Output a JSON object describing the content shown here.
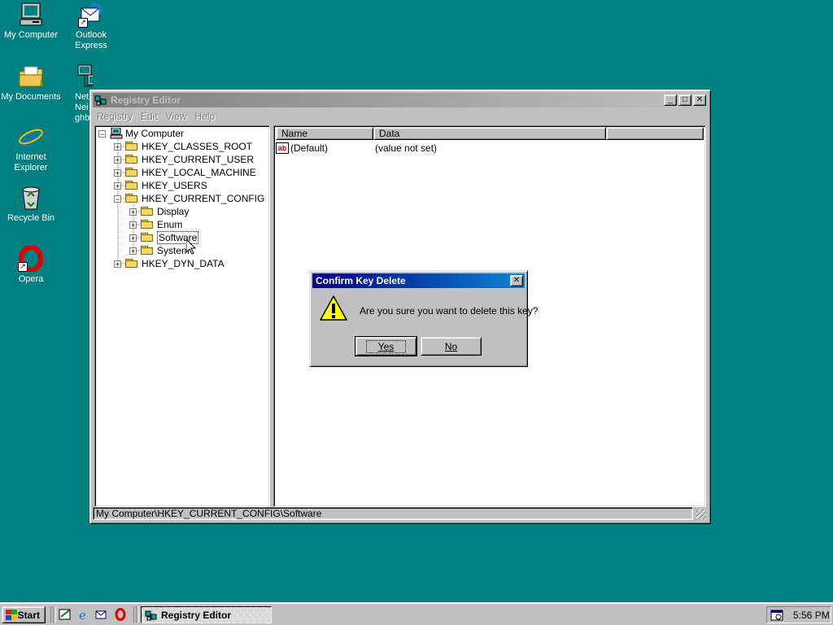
{
  "desktop": {
    "icons": [
      {
        "label": "My Computer",
        "icon": "my-computer-icon"
      },
      {
        "label": "Outlook Express",
        "icon": "outlook-express-icon"
      },
      {
        "label": "My Documents",
        "icon": "my-documents-icon"
      },
      {
        "label": "Network Neighborhood",
        "visible_label": "Net Neighb",
        "icon": "network-icon"
      },
      {
        "label": "Internet Explorer",
        "icon": "internet-explorer-icon"
      },
      {
        "label": "Recycle Bin",
        "icon": "recycle-bin-icon"
      },
      {
        "label": "Opera",
        "icon": "opera-icon"
      }
    ]
  },
  "regedit": {
    "title": "Registry Editor",
    "menu": [
      "Registry",
      "Edit",
      "View",
      "Help"
    ],
    "tree": {
      "root": "My Computer",
      "keys": [
        "HKEY_CLASSES_ROOT",
        "HKEY_CURRENT_USER",
        "HKEY_LOCAL_MACHINE",
        "HKEY_USERS",
        "HKEY_CURRENT_CONFIG"
      ],
      "children": [
        "Display",
        "Enum",
        "Software",
        "System"
      ],
      "last_key": "HKEY_DYN_DATA",
      "selected": "Software"
    },
    "list": {
      "columns": [
        "Name",
        "Data"
      ],
      "rows": [
        {
          "name": "(Default)",
          "data": "(value not set)"
        }
      ]
    },
    "status": "My Computer\\HKEY_CURRENT_CONFIG\\Software"
  },
  "dialog": {
    "title": "Confirm Key Delete",
    "message": "Are you sure you want to delete this key?",
    "yes": "Yes",
    "no": "No",
    "close": "✕"
  },
  "taskbar": {
    "start": "Start",
    "task": "Registry Editor",
    "clock": "5:56 PM"
  },
  "colors": {
    "desktop": "#008080",
    "active_title": "#000080",
    "face": "#c0c0c0"
  }
}
